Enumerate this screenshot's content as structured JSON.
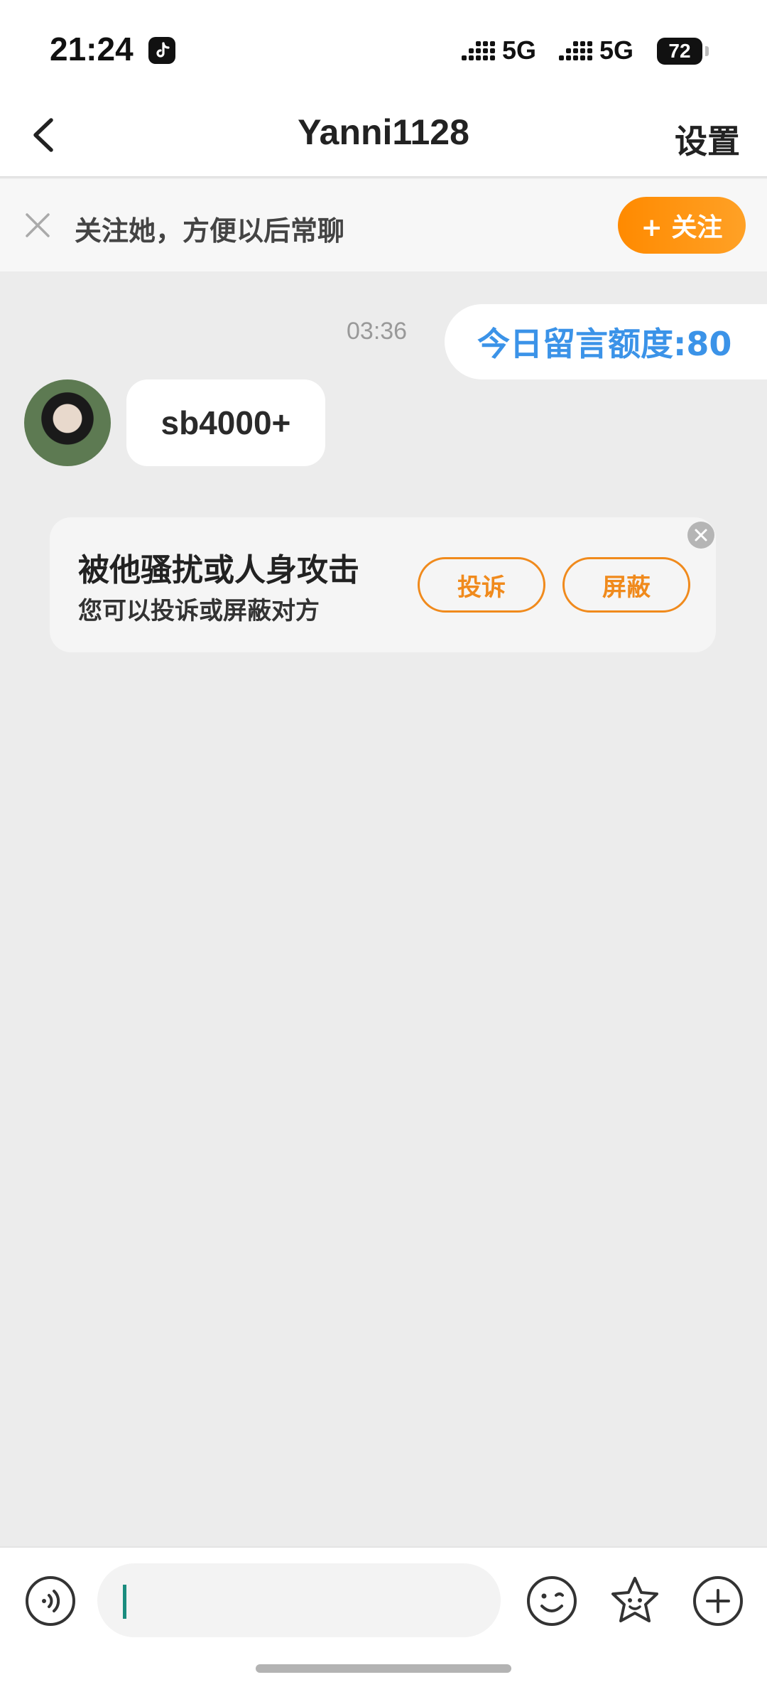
{
  "status_bar": {
    "time": "21:24",
    "network_1": "5G",
    "network_2": "5G",
    "battery": "72",
    "app_icon": "tiktok-icon"
  },
  "nav": {
    "title": "Yanni1128",
    "settings_label": "设置",
    "back_icon": "chevron-left-icon"
  },
  "follow_banner": {
    "text": "关注她，方便以后常聊",
    "button_label": "+ 关注"
  },
  "chat": {
    "timestamp": "03:36",
    "quota_text": "今日留言额度:80",
    "messages": [
      {
        "sender": "Yanni1128",
        "text": "sb4000+"
      }
    ]
  },
  "harass_card": {
    "title": "被他骚扰或人身攻击",
    "subtitle": "您可以投诉或屏蔽对方",
    "complain_label": "投诉",
    "block_label": "屏蔽"
  },
  "input_bar": {
    "value": "",
    "icons": [
      "voice-icon",
      "emoji-icon",
      "sticker-icon",
      "plus-icon"
    ]
  },
  "colors": {
    "accent_orange": "#ff8a00",
    "quota_blue": "#3b93e8",
    "background": "#ececec"
  }
}
